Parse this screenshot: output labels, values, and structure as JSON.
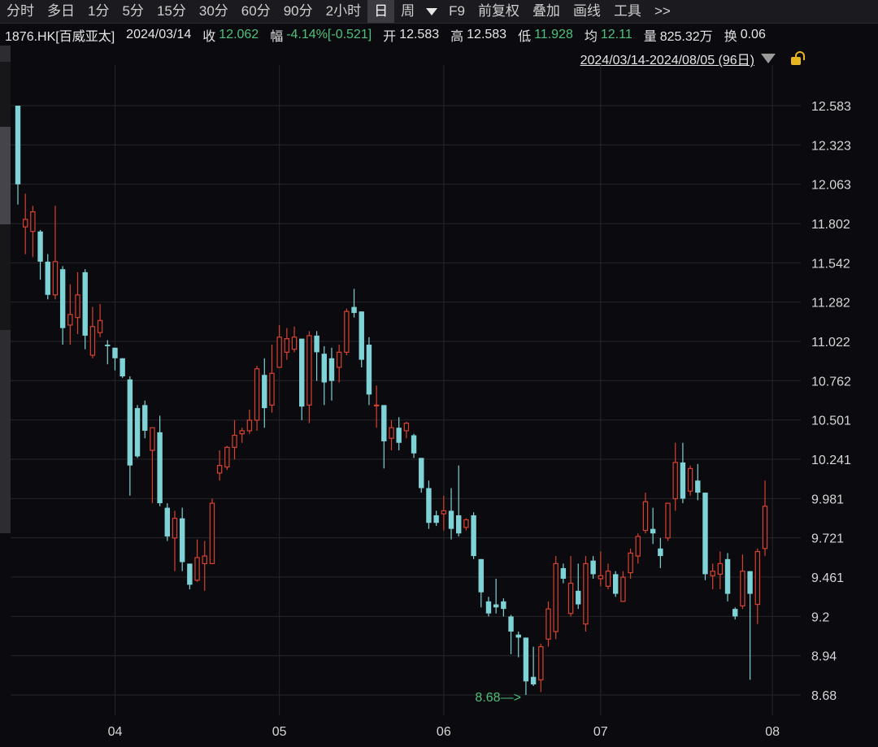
{
  "toolbar": {
    "items": [
      "分时",
      "多日",
      "1分",
      "5分",
      "15分",
      "30分",
      "60分",
      "90分",
      "2小时",
      "日",
      "周"
    ],
    "active": "日",
    "items_right": [
      "F9",
      "前复权",
      "叠加",
      "画线",
      "工具",
      ">>"
    ]
  },
  "info": {
    "code": "1876.HK[百威亚太]",
    "date": "2024/03/14",
    "close_label": "收",
    "close": "12.062",
    "change_label": "幅",
    "change": "-4.14%[-0.521]",
    "open_label": "开",
    "open": "12.583",
    "high_label": "高",
    "high": "12.583",
    "low_label": "低",
    "low": "11.928",
    "avg_label": "均",
    "avg": "12.11",
    "volume_label": "量",
    "volume": "825.32万",
    "turnover_label": "换",
    "turnover": "0.06"
  },
  "range": {
    "text": "2024/03/14-2024/08/05 (96日)"
  },
  "colors": {
    "up": "#d9412f",
    "down": "#7fd3d6",
    "grid": "#26262b",
    "background": "#0b0b0f",
    "annotation": "#4ec07a"
  },
  "chart_data": {
    "type": "candlestick",
    "title": "",
    "x_tick_labels": [
      "04",
      "05",
      "06",
      "07",
      "08"
    ],
    "x_tick_index": [
      13,
      35,
      57,
      78,
      101
    ],
    "y_tick_labels": [
      "12.583",
      "12.323",
      "12.063",
      "11.802",
      "11.542",
      "11.282",
      "11.022",
      "10.762",
      "10.501",
      "10.241",
      "9.981",
      "9.721",
      "9.461",
      "9.2",
      "8.94",
      "8.68"
    ],
    "ylim": [
      8.68,
      12.583
    ],
    "grid": true,
    "min_annotation": {
      "label": "8.68",
      "index": 68
    },
    "candles": [
      {
        "o": 12.583,
        "h": 12.583,
        "l": 11.928,
        "c": 12.062
      },
      {
        "o": 11.78,
        "h": 12.0,
        "l": 11.6,
        "c": 11.83
      },
      {
        "o": 11.75,
        "h": 11.92,
        "l": 11.58,
        "c": 11.88
      },
      {
        "o": 11.75,
        "h": 11.76,
        "l": 11.43,
        "c": 11.55
      },
      {
        "o": 11.55,
        "h": 11.6,
        "l": 11.3,
        "c": 11.33
      },
      {
        "o": 11.33,
        "h": 11.92,
        "l": 11.3,
        "c": 11.55
      },
      {
        "o": 11.5,
        "h": 11.52,
        "l": 11.0,
        "c": 11.11
      },
      {
        "o": 11.13,
        "h": 11.4,
        "l": 11.0,
        "c": 11.2
      },
      {
        "o": 11.18,
        "h": 11.48,
        "l": 11.07,
        "c": 11.33
      },
      {
        "o": 11.48,
        "h": 11.5,
        "l": 10.97,
        "c": 11.06
      },
      {
        "o": 10.93,
        "h": 11.25,
        "l": 10.91,
        "c": 11.12
      },
      {
        "o": 11.08,
        "h": 11.27,
        "l": 11.05,
        "c": 11.16
      },
      {
        "o": 11.0,
        "h": 11.03,
        "l": 10.87,
        "c": 10.99
      },
      {
        "o": 10.98,
        "h": 10.98,
        "l": 10.83,
        "c": 10.91
      },
      {
        "o": 10.91,
        "h": 10.91,
        "l": 10.78,
        "c": 10.79
      },
      {
        "o": 10.77,
        "h": 10.79,
        "l": 10.0,
        "c": 10.2
      },
      {
        "o": 10.58,
        "h": 10.6,
        "l": 10.25,
        "c": 10.26
      },
      {
        "o": 10.6,
        "h": 10.63,
        "l": 10.38,
        "c": 10.43
      },
      {
        "o": 10.3,
        "h": 10.45,
        "l": 9.95,
        "c": 10.45
      },
      {
        "o": 10.42,
        "h": 10.53,
        "l": 9.93,
        "c": 9.95
      },
      {
        "o": 9.92,
        "h": 9.95,
        "l": 9.7,
        "c": 9.73
      },
      {
        "o": 9.72,
        "h": 9.9,
        "l": 9.5,
        "c": 9.85
      },
      {
        "o": 9.85,
        "h": 9.92,
        "l": 9.5,
        "c": 9.56
      },
      {
        "o": 9.55,
        "h": 9.55,
        "l": 9.38,
        "c": 9.41
      },
      {
        "o": 9.44,
        "h": 9.71,
        "l": 9.43,
        "c": 9.59
      },
      {
        "o": 9.55,
        "h": 9.7,
        "l": 9.37,
        "c": 9.6
      },
      {
        "o": 9.55,
        "h": 9.98,
        "l": 9.55,
        "c": 9.95
      },
      {
        "o": 10.15,
        "h": 10.3,
        "l": 10.1,
        "c": 10.2
      },
      {
        "o": 10.19,
        "h": 10.33,
        "l": 10.17,
        "c": 10.32
      },
      {
        "o": 10.32,
        "h": 10.5,
        "l": 10.24,
        "c": 10.4
      },
      {
        "o": 10.41,
        "h": 10.45,
        "l": 10.35,
        "c": 10.43
      },
      {
        "o": 10.43,
        "h": 10.57,
        "l": 10.41,
        "c": 10.5
      },
      {
        "o": 10.5,
        "h": 10.86,
        "l": 10.43,
        "c": 10.84
      },
      {
        "o": 10.8,
        "h": 10.91,
        "l": 10.45,
        "c": 10.58
      },
      {
        "o": 10.6,
        "h": 11.0,
        "l": 10.55,
        "c": 10.81
      },
      {
        "o": 10.85,
        "h": 11.13,
        "l": 10.85,
        "c": 11.05
      },
      {
        "o": 10.95,
        "h": 11.11,
        "l": 10.9,
        "c": 11.04
      },
      {
        "o": 10.97,
        "h": 11.12,
        "l": 10.95,
        "c": 11.05
      },
      {
        "o": 11.04,
        "h": 11.04,
        "l": 10.5,
        "c": 10.59
      },
      {
        "o": 10.6,
        "h": 11.09,
        "l": 10.48,
        "c": 11.06
      },
      {
        "o": 11.06,
        "h": 11.09,
        "l": 10.76,
        "c": 10.95
      },
      {
        "o": 10.94,
        "h": 10.99,
        "l": 10.6,
        "c": 10.75
      },
      {
        "o": 10.91,
        "h": 10.98,
        "l": 10.63,
        "c": 10.76
      },
      {
        "o": 10.85,
        "h": 11.0,
        "l": 10.75,
        "c": 10.95
      },
      {
        "o": 10.95,
        "h": 11.24,
        "l": 10.93,
        "c": 11.22
      },
      {
        "o": 11.25,
        "h": 11.37,
        "l": 11.18,
        "c": 11.21
      },
      {
        "o": 11.22,
        "h": 11.22,
        "l": 10.85,
        "c": 10.9
      },
      {
        "o": 11.0,
        "h": 11.05,
        "l": 10.6,
        "c": 10.67
      },
      {
        "o": 10.6,
        "h": 10.73,
        "l": 10.45,
        "c": 10.6
      },
      {
        "o": 10.6,
        "h": 10.6,
        "l": 10.18,
        "c": 10.36
      },
      {
        "o": 10.38,
        "h": 10.5,
        "l": 10.3,
        "c": 10.45
      },
      {
        "o": 10.45,
        "h": 10.52,
        "l": 10.3,
        "c": 10.35
      },
      {
        "o": 10.43,
        "h": 10.49,
        "l": 10.38,
        "c": 10.48
      },
      {
        "o": 10.4,
        "h": 10.41,
        "l": 10.25,
        "c": 10.28
      },
      {
        "o": 10.25,
        "h": 10.25,
        "l": 10.02,
        "c": 10.05
      },
      {
        "o": 10.05,
        "h": 10.1,
        "l": 9.78,
        "c": 9.82
      },
      {
        "o": 9.87,
        "h": 9.9,
        "l": 9.8,
        "c": 9.82
      },
      {
        "o": 9.88,
        "h": 10.0,
        "l": 9.77,
        "c": 9.9
      },
      {
        "o": 9.9,
        "h": 10.05,
        "l": 9.71,
        "c": 9.78
      },
      {
        "o": 9.87,
        "h": 10.2,
        "l": 9.73,
        "c": 9.75
      },
      {
        "o": 9.79,
        "h": 9.85,
        "l": 9.77,
        "c": 9.84
      },
      {
        "o": 9.87,
        "h": 9.89,
        "l": 9.58,
        "c": 9.6
      },
      {
        "o": 9.58,
        "h": 9.58,
        "l": 9.26,
        "c": 9.36
      },
      {
        "o": 9.3,
        "h": 9.33,
        "l": 9.2,
        "c": 9.22
      },
      {
        "o": 9.28,
        "h": 9.45,
        "l": 9.22,
        "c": 9.26
      },
      {
        "o": 9.3,
        "h": 9.32,
        "l": 9.2,
        "c": 9.25
      },
      {
        "o": 9.2,
        "h": 9.21,
        "l": 8.95,
        "c": 9.1
      },
      {
        "o": 9.08,
        "h": 9.1,
        "l": 8.93,
        "c": 9.06
      },
      {
        "o": 9.06,
        "h": 9.06,
        "l": 8.68,
        "c": 8.77
      },
      {
        "o": 8.8,
        "h": 9.0,
        "l": 8.74,
        "c": 8.75
      },
      {
        "o": 8.78,
        "h": 9.02,
        "l": 8.7,
        "c": 9.0
      },
      {
        "o": 9.05,
        "h": 9.3,
        "l": 9.0,
        "c": 9.25
      },
      {
        "o": 9.1,
        "h": 9.6,
        "l": 9.05,
        "c": 9.55
      },
      {
        "o": 9.52,
        "h": 9.55,
        "l": 9.42,
        "c": 9.45
      },
      {
        "o": 9.22,
        "h": 9.6,
        "l": 9.2,
        "c": 9.42
      },
      {
        "o": 9.37,
        "h": 9.55,
        "l": 9.25,
        "c": 9.28
      },
      {
        "o": 9.15,
        "h": 9.6,
        "l": 9.1,
        "c": 9.55
      },
      {
        "o": 9.57,
        "h": 9.6,
        "l": 9.45,
        "c": 9.48
      },
      {
        "o": 9.45,
        "h": 9.63,
        "l": 9.4,
        "c": 9.47
      },
      {
        "o": 9.4,
        "h": 9.55,
        "l": 9.38,
        "c": 9.5
      },
      {
        "o": 9.48,
        "h": 9.5,
        "l": 9.33,
        "c": 9.35
      },
      {
        "o": 9.3,
        "h": 9.5,
        "l": 9.3,
        "c": 9.46
      },
      {
        "o": 9.49,
        "h": 9.65,
        "l": 9.45,
        "c": 9.62
      },
      {
        "o": 9.6,
        "h": 9.75,
        "l": 9.55,
        "c": 9.73
      },
      {
        "o": 9.77,
        "h": 10.02,
        "l": 9.75,
        "c": 9.96
      },
      {
        "o": 9.78,
        "h": 9.92,
        "l": 9.68,
        "c": 9.75
      },
      {
        "o": 9.65,
        "h": 9.72,
        "l": 9.52,
        "c": 9.6
      },
      {
        "o": 9.72,
        "h": 9.92,
        "l": 9.7,
        "c": 9.95
      },
      {
        "o": 9.98,
        "h": 10.35,
        "l": 9.9,
        "c": 10.22
      },
      {
        "o": 10.22,
        "h": 10.35,
        "l": 9.95,
        "c": 9.98
      },
      {
        "o": 10.03,
        "h": 10.2,
        "l": 10.0,
        "c": 10.18
      },
      {
        "o": 10.1,
        "h": 10.21,
        "l": 9.97,
        "c": 10.02
      },
      {
        "o": 10.02,
        "h": 10.02,
        "l": 9.44,
        "c": 9.48
      },
      {
        "o": 9.47,
        "h": 9.55,
        "l": 9.38,
        "c": 9.5
      },
      {
        "o": 9.48,
        "h": 9.63,
        "l": 9.38,
        "c": 9.55
      },
      {
        "o": 9.58,
        "h": 9.62,
        "l": 9.3,
        "c": 9.35
      },
      {
        "o": 9.25,
        "h": 9.26,
        "l": 9.18,
        "c": 9.2
      },
      {
        "o": 9.27,
        "h": 9.61,
        "l": 9.25,
        "c": 9.5
      },
      {
        "o": 9.5,
        "h": 9.5,
        "l": 8.78,
        "c": 9.35
      },
      {
        "o": 9.28,
        "h": 9.65,
        "l": 9.15,
        "c": 9.63
      },
      {
        "o": 9.65,
        "h": 10.1,
        "l": 9.6,
        "c": 9.93
      }
    ]
  }
}
